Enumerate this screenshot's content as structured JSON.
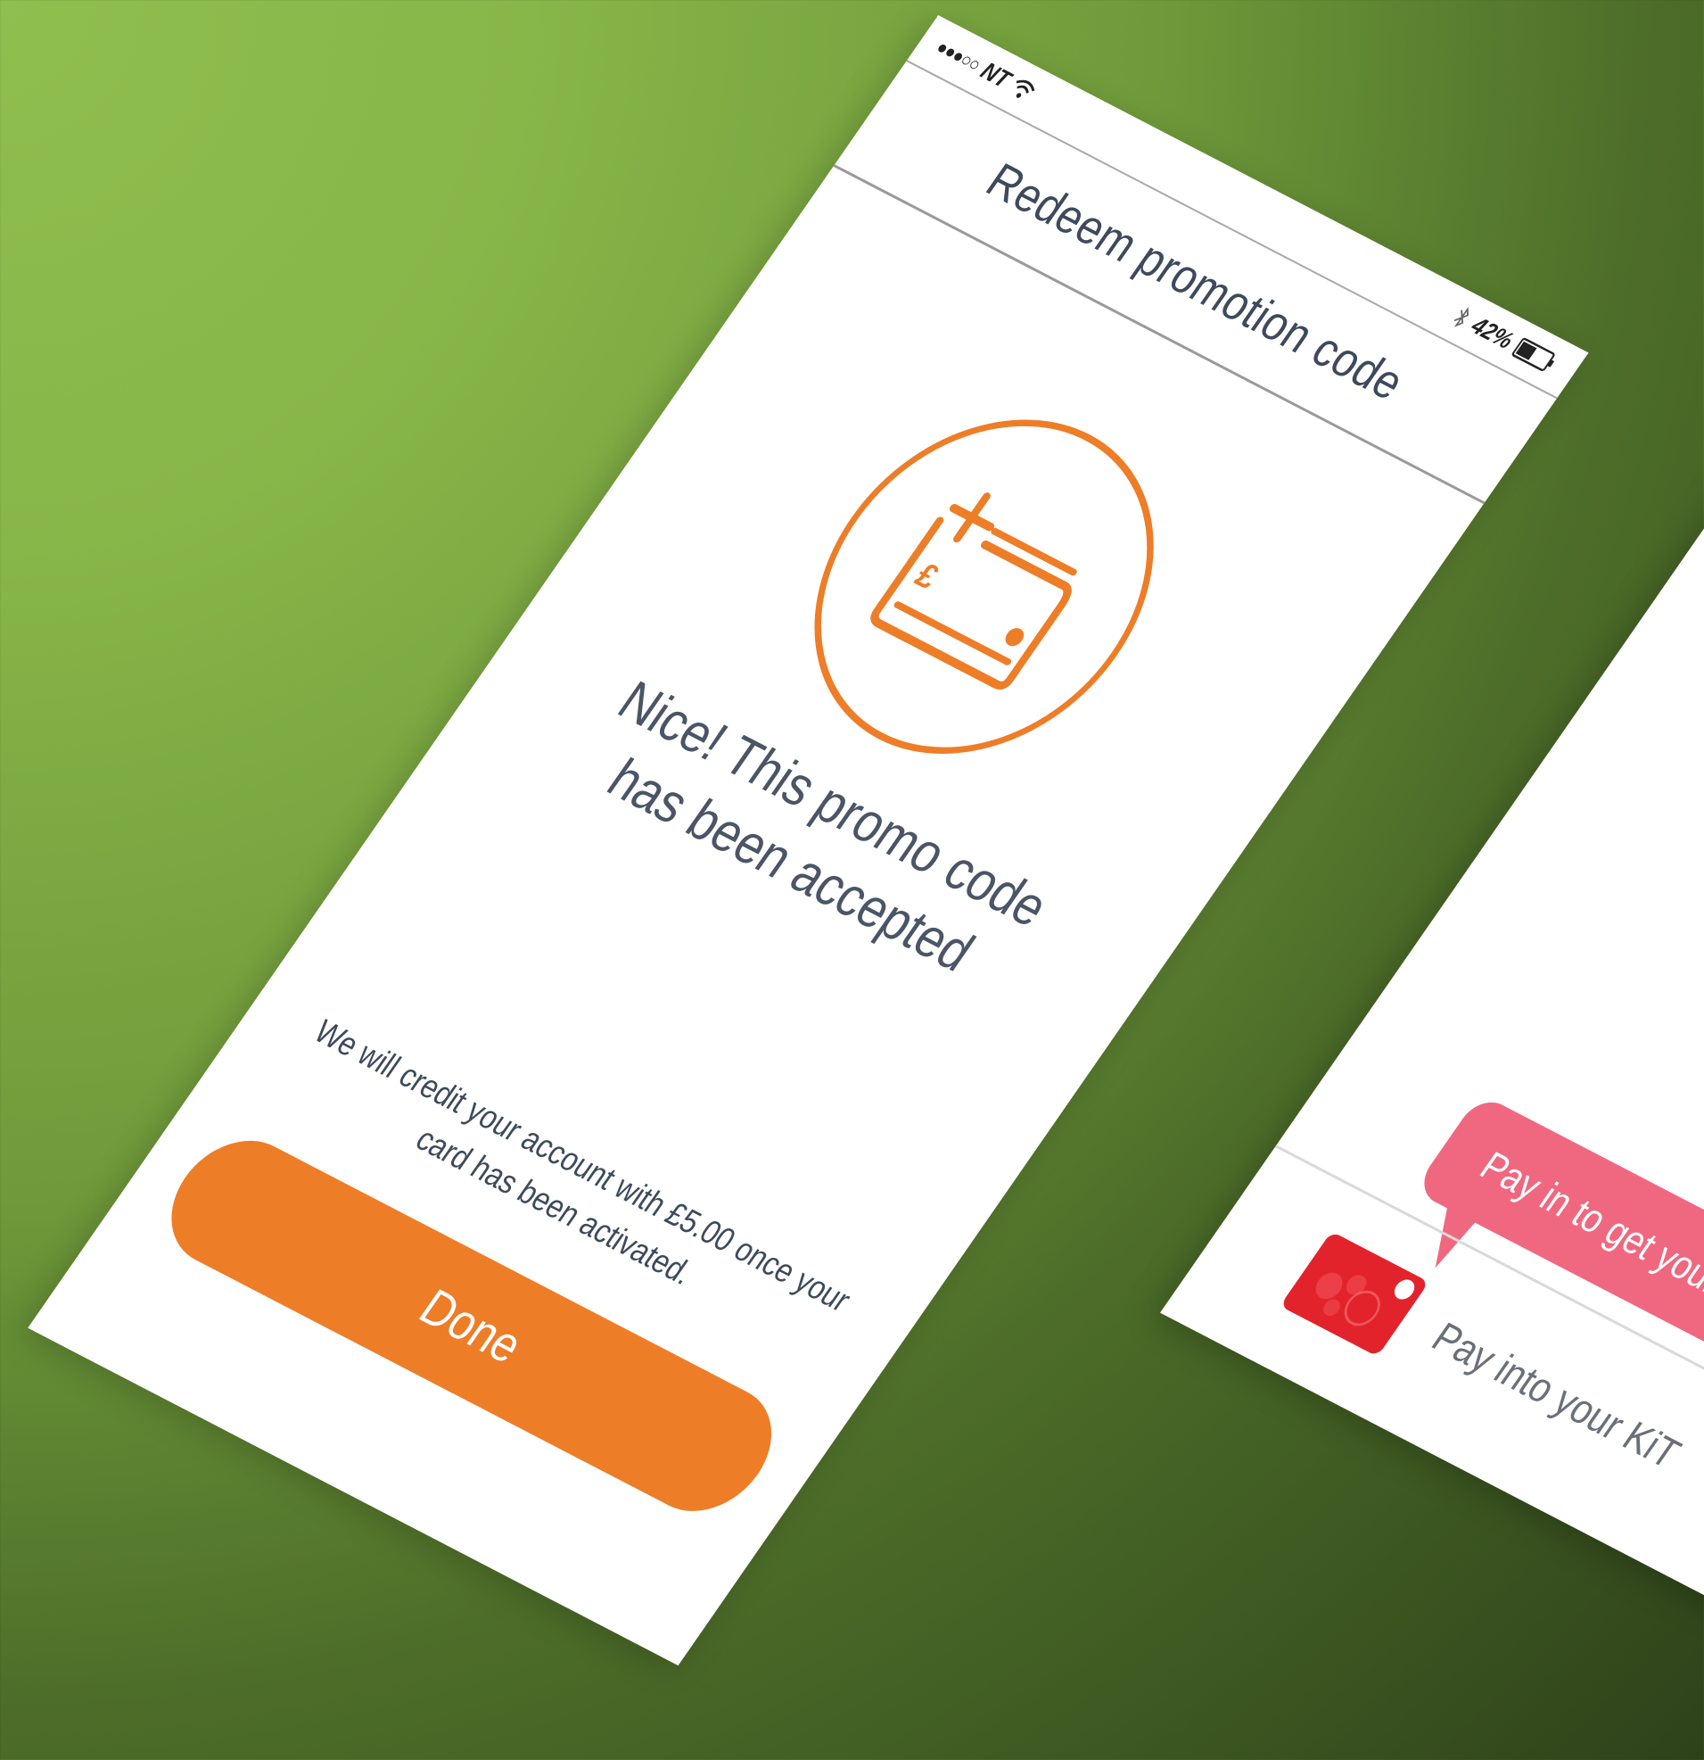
{
  "status_bar": {
    "carrier": "NT",
    "signal_dots": "●●●○○",
    "battery_percent": "42%",
    "icons": [
      "wifi-icon",
      "bluetooth-icon",
      "battery-icon"
    ]
  },
  "header": {
    "title": "Redeem promotion code"
  },
  "success": {
    "icon": "pound-card-plus-icon",
    "headline": "Nice! This promo code has been accepted",
    "note": "We will credit your account with £5.00 once your card has been activated."
  },
  "actions": {
    "done_label": "Done"
  },
  "second_screen": {
    "tooltip": "Pay in to get your f",
    "pay_in_label": "Pay into your KiT"
  },
  "colors": {
    "accent_orange": "#ee7d28",
    "tooltip_pink": "#f06880",
    "card_red": "#e3232b",
    "text_dark": "#3d4a5c",
    "background_green": "#87b649"
  }
}
